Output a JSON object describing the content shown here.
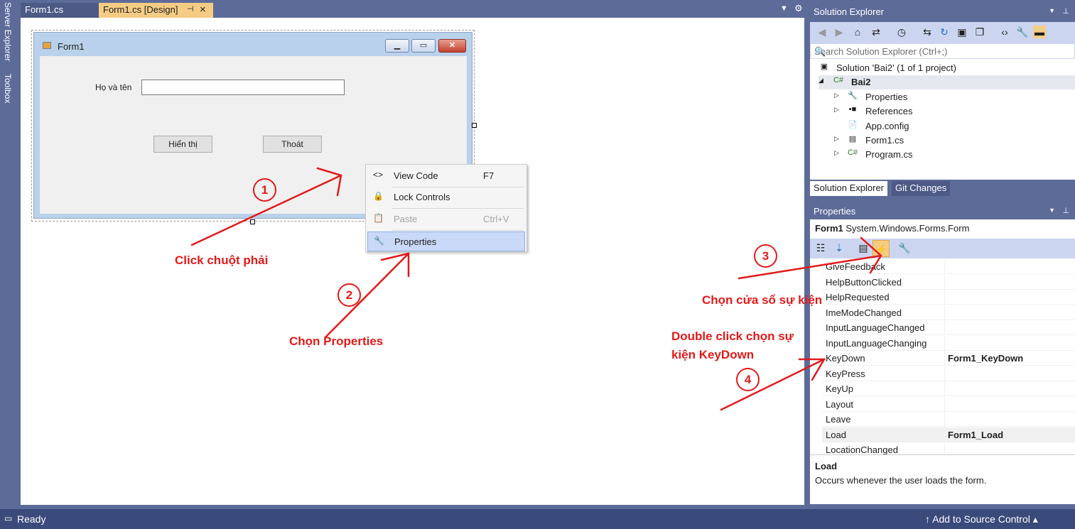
{
  "tabs": [
    {
      "label": "Form1.cs"
    },
    {
      "label": "Form1.cs [Design]"
    }
  ],
  "left_strip": {
    "server_explorer": "Server Explorer",
    "toolbox": "Toolbox"
  },
  "form": {
    "caption": "Form1",
    "label_name": "Họ và tên",
    "textbox_value": "",
    "btn_show": "Hiển thị",
    "btn_exit": "Thoát"
  },
  "context_menu": {
    "items": [
      {
        "label": "View Code",
        "shortcut": "F7",
        "icon": "code-icon",
        "state": "enabled"
      },
      {
        "label": "Lock Controls",
        "shortcut": "",
        "icon": "lock-icon",
        "state": "enabled"
      },
      {
        "label": "Paste",
        "shortcut": "Ctrl+V",
        "icon": "paste-icon",
        "state": "disabled"
      },
      {
        "label": "Properties",
        "shortcut": "",
        "icon": "wrench-icon",
        "state": "selected"
      }
    ]
  },
  "solution_explorer": {
    "title": "Solution Explorer",
    "search_placeholder": "Search Solution Explorer (Ctrl+;)",
    "tree": [
      {
        "label": "Solution 'Bai2' (1 of 1 project)",
        "icon": "solution-icon"
      },
      {
        "label": "Bai2",
        "icon": "csharp-project-icon"
      },
      {
        "label": "Properties",
        "icon": "wrench-icon"
      },
      {
        "label": "References",
        "icon": "references-icon"
      },
      {
        "label": "App.config",
        "icon": "config-file-icon"
      },
      {
        "label": "Form1.cs",
        "icon": "form-file-icon"
      },
      {
        "label": "Program.cs",
        "icon": "csharp-file-icon"
      }
    ],
    "bottom_tabs": [
      "Solution Explorer",
      "Git Changes"
    ]
  },
  "properties": {
    "title": "Properties",
    "object_name": "Form1",
    "object_type": "System.Windows.Forms.Form",
    "events": [
      {
        "name": "GiveFeedback",
        "value": ""
      },
      {
        "name": "HelpButtonClicked",
        "value": ""
      },
      {
        "name": "HelpRequested",
        "value": ""
      },
      {
        "name": "ImeModeChanged",
        "value": ""
      },
      {
        "name": "InputLanguageChanged",
        "value": ""
      },
      {
        "name": "InputLanguageChanging",
        "value": ""
      },
      {
        "name": "KeyDown",
        "value": "Form1_KeyDown"
      },
      {
        "name": "KeyPress",
        "value": ""
      },
      {
        "name": "KeyUp",
        "value": ""
      },
      {
        "name": "Layout",
        "value": ""
      },
      {
        "name": "Leave",
        "value": ""
      },
      {
        "name": "Load",
        "value": "Form1_Load"
      },
      {
        "name": "LocationChanged",
        "value": ""
      }
    ],
    "description_name": "Load",
    "description_text": "Occurs whenever the user loads the form."
  },
  "status": {
    "text": "Ready",
    "source_control": "Add to Source Control"
  },
  "annotations": {
    "step1_num": "1",
    "step1_text": "Click chuột phải",
    "step2_num": "2",
    "step2_text": "Chọn Properties",
    "step3_num": "3",
    "step3_text": "Chọn cửa sổ sự kiện",
    "step4_num": "4",
    "step4_text_line1": "Double click chọn sự",
    "step4_text_line2": "kiện KeyDown"
  },
  "colors": {
    "annotation": "#e21a1a",
    "vs_frame": "#5d6b99",
    "active_tab": "#f5cc84",
    "menu_selected": "#c9d9f7"
  }
}
